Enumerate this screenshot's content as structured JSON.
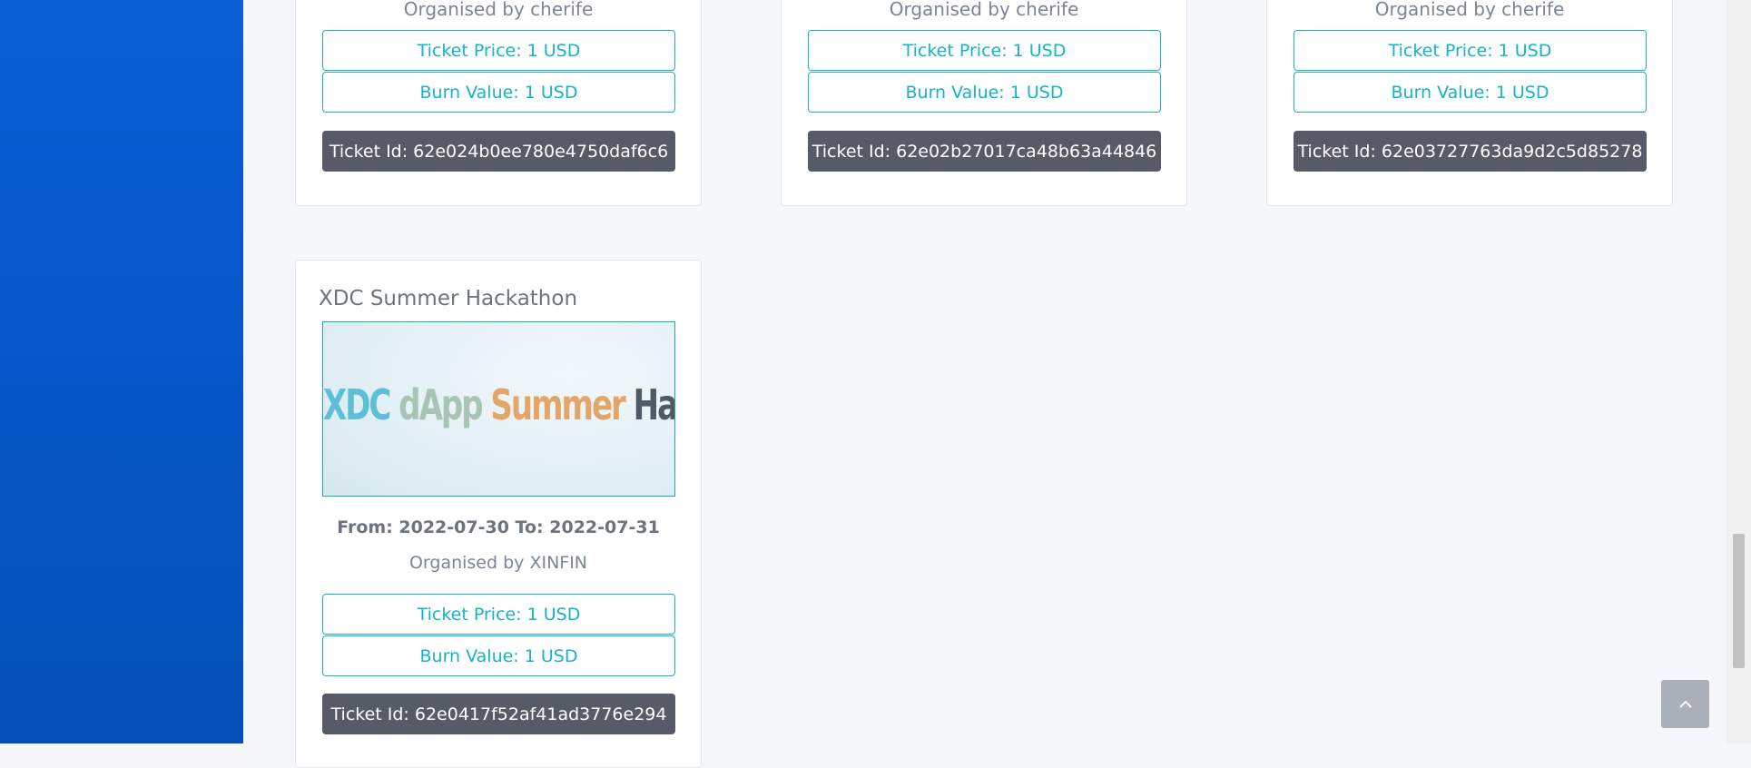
{
  "cards_top": [
    {
      "organiser_cut": "Organised by cherife",
      "ticket_price": "Ticket Price: 1 USD",
      "burn_value": "Burn Value: 1 USD",
      "ticket_id": "Ticket Id: 62e024b0ee780e4750daf6c6"
    },
    {
      "organiser_cut": "Organised by cherife",
      "ticket_price": "Ticket Price: 1 USD",
      "burn_value": "Burn Value: 1 USD",
      "ticket_id": "Ticket Id: 62e02b27017ca48b63a44846"
    },
    {
      "organiser_cut": "Organised by cherife",
      "ticket_price": "Ticket Price: 1 USD",
      "burn_value": "Burn Value: 1 USD",
      "ticket_id": "Ticket Id: 62e03727763da9d2c5d85278"
    }
  ],
  "event_card": {
    "title": "XDC Summer Hackathon",
    "banner": {
      "word1": "XDC",
      "word2": "dApp",
      "word3": "Summer",
      "word4": "Hackathon"
    },
    "dates": "From: 2022-07-30 To: 2022-07-31",
    "organiser": "Organised by XINFIN",
    "ticket_price": "Ticket Price: 1 USD",
    "burn_value": "Burn Value: 1 USD",
    "ticket_id": "Ticket Id: 62e0417f52af41ad3776e294"
  },
  "icons": {
    "back_to_top": "chevron-up-icon"
  },
  "colors": {
    "sidebar": "#0a5ed6",
    "accent": "#17b3c9",
    "dark_button": "#565b67"
  }
}
